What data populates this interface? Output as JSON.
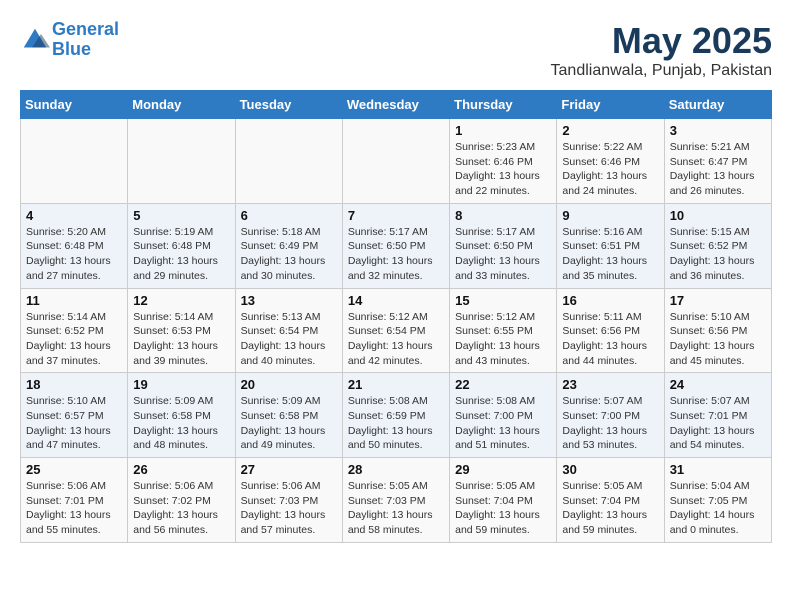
{
  "header": {
    "logo_line1": "General",
    "logo_line2": "Blue",
    "title": "May 2025",
    "subtitle": "Tandlianwala, Punjab, Pakistan"
  },
  "weekdays": [
    "Sunday",
    "Monday",
    "Tuesday",
    "Wednesday",
    "Thursday",
    "Friday",
    "Saturday"
  ],
  "weeks": [
    [
      {
        "day": "",
        "info": ""
      },
      {
        "day": "",
        "info": ""
      },
      {
        "day": "",
        "info": ""
      },
      {
        "day": "",
        "info": ""
      },
      {
        "day": "1",
        "info": "Sunrise: 5:23 AM\nSunset: 6:46 PM\nDaylight: 13 hours\nand 22 minutes."
      },
      {
        "day": "2",
        "info": "Sunrise: 5:22 AM\nSunset: 6:46 PM\nDaylight: 13 hours\nand 24 minutes."
      },
      {
        "day": "3",
        "info": "Sunrise: 5:21 AM\nSunset: 6:47 PM\nDaylight: 13 hours\nand 26 minutes."
      }
    ],
    [
      {
        "day": "4",
        "info": "Sunrise: 5:20 AM\nSunset: 6:48 PM\nDaylight: 13 hours\nand 27 minutes."
      },
      {
        "day": "5",
        "info": "Sunrise: 5:19 AM\nSunset: 6:48 PM\nDaylight: 13 hours\nand 29 minutes."
      },
      {
        "day": "6",
        "info": "Sunrise: 5:18 AM\nSunset: 6:49 PM\nDaylight: 13 hours\nand 30 minutes."
      },
      {
        "day": "7",
        "info": "Sunrise: 5:17 AM\nSunset: 6:50 PM\nDaylight: 13 hours\nand 32 minutes."
      },
      {
        "day": "8",
        "info": "Sunrise: 5:17 AM\nSunset: 6:50 PM\nDaylight: 13 hours\nand 33 minutes."
      },
      {
        "day": "9",
        "info": "Sunrise: 5:16 AM\nSunset: 6:51 PM\nDaylight: 13 hours\nand 35 minutes."
      },
      {
        "day": "10",
        "info": "Sunrise: 5:15 AM\nSunset: 6:52 PM\nDaylight: 13 hours\nand 36 minutes."
      }
    ],
    [
      {
        "day": "11",
        "info": "Sunrise: 5:14 AM\nSunset: 6:52 PM\nDaylight: 13 hours\nand 37 minutes."
      },
      {
        "day": "12",
        "info": "Sunrise: 5:14 AM\nSunset: 6:53 PM\nDaylight: 13 hours\nand 39 minutes."
      },
      {
        "day": "13",
        "info": "Sunrise: 5:13 AM\nSunset: 6:54 PM\nDaylight: 13 hours\nand 40 minutes."
      },
      {
        "day": "14",
        "info": "Sunrise: 5:12 AM\nSunset: 6:54 PM\nDaylight: 13 hours\nand 42 minutes."
      },
      {
        "day": "15",
        "info": "Sunrise: 5:12 AM\nSunset: 6:55 PM\nDaylight: 13 hours\nand 43 minutes."
      },
      {
        "day": "16",
        "info": "Sunrise: 5:11 AM\nSunset: 6:56 PM\nDaylight: 13 hours\nand 44 minutes."
      },
      {
        "day": "17",
        "info": "Sunrise: 5:10 AM\nSunset: 6:56 PM\nDaylight: 13 hours\nand 45 minutes."
      }
    ],
    [
      {
        "day": "18",
        "info": "Sunrise: 5:10 AM\nSunset: 6:57 PM\nDaylight: 13 hours\nand 47 minutes."
      },
      {
        "day": "19",
        "info": "Sunrise: 5:09 AM\nSunset: 6:58 PM\nDaylight: 13 hours\nand 48 minutes."
      },
      {
        "day": "20",
        "info": "Sunrise: 5:09 AM\nSunset: 6:58 PM\nDaylight: 13 hours\nand 49 minutes."
      },
      {
        "day": "21",
        "info": "Sunrise: 5:08 AM\nSunset: 6:59 PM\nDaylight: 13 hours\nand 50 minutes."
      },
      {
        "day": "22",
        "info": "Sunrise: 5:08 AM\nSunset: 7:00 PM\nDaylight: 13 hours\nand 51 minutes."
      },
      {
        "day": "23",
        "info": "Sunrise: 5:07 AM\nSunset: 7:00 PM\nDaylight: 13 hours\nand 53 minutes."
      },
      {
        "day": "24",
        "info": "Sunrise: 5:07 AM\nSunset: 7:01 PM\nDaylight: 13 hours\nand 54 minutes."
      }
    ],
    [
      {
        "day": "25",
        "info": "Sunrise: 5:06 AM\nSunset: 7:01 PM\nDaylight: 13 hours\nand 55 minutes."
      },
      {
        "day": "26",
        "info": "Sunrise: 5:06 AM\nSunset: 7:02 PM\nDaylight: 13 hours\nand 56 minutes."
      },
      {
        "day": "27",
        "info": "Sunrise: 5:06 AM\nSunset: 7:03 PM\nDaylight: 13 hours\nand 57 minutes."
      },
      {
        "day": "28",
        "info": "Sunrise: 5:05 AM\nSunset: 7:03 PM\nDaylight: 13 hours\nand 58 minutes."
      },
      {
        "day": "29",
        "info": "Sunrise: 5:05 AM\nSunset: 7:04 PM\nDaylight: 13 hours\nand 59 minutes."
      },
      {
        "day": "30",
        "info": "Sunrise: 5:05 AM\nSunset: 7:04 PM\nDaylight: 13 hours\nand 59 minutes."
      },
      {
        "day": "31",
        "info": "Sunrise: 5:04 AM\nSunset: 7:05 PM\nDaylight: 14 hours\nand 0 minutes."
      }
    ]
  ]
}
